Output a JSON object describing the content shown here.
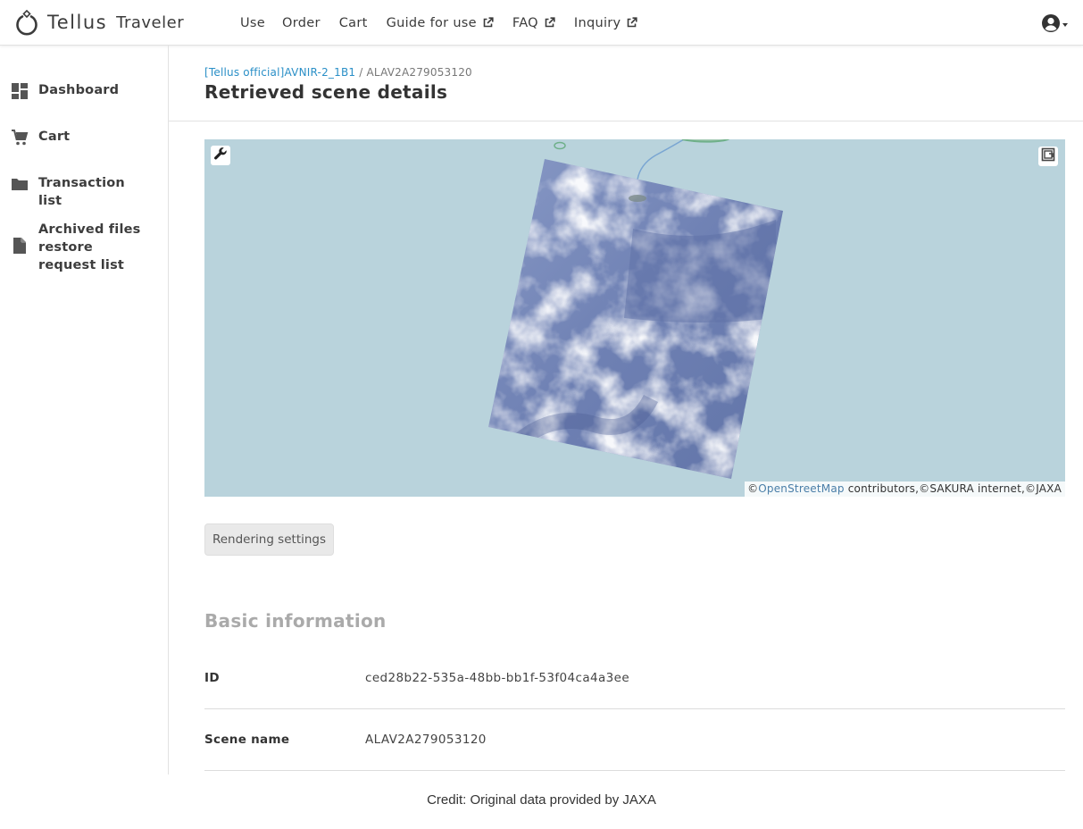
{
  "app": {
    "logo_text": "Tellus",
    "logo_sub": "Traveler"
  },
  "topnav": {
    "items": [
      {
        "label": "Use",
        "external": false
      },
      {
        "label": "Order",
        "external": false
      },
      {
        "label": "Cart",
        "external": false
      },
      {
        "label": "Guide for use",
        "external": true
      },
      {
        "label": "FAQ",
        "external": true
      },
      {
        "label": "Inquiry",
        "external": true
      }
    ],
    "user_icon": "user-circle-icon"
  },
  "sidebar": {
    "items": [
      {
        "label": "Dashboard",
        "icon": "dashboard-icon"
      },
      {
        "label": "Cart",
        "icon": "cart-icon"
      },
      {
        "label": "Transaction list",
        "icon": "folder-icon"
      },
      {
        "label": "Archived files restore request list",
        "icon": "file-icon"
      }
    ]
  },
  "breadcrumb": {
    "link": "[Tellus official]AVNIR-2_1B1",
    "separator": "/",
    "current": "ALAV2A279053120"
  },
  "page": {
    "title": "Retrieved scene details"
  },
  "map": {
    "attribution_prefix": "©",
    "attribution_link": "OpenStreetMap",
    "attribution_suffix": " contributors,©SAKURA internet,©JAXA",
    "tool_icon": "wrench-icon",
    "fullscreen_icon": "fullscreen-icon",
    "water_color": "#b9d3dc"
  },
  "buttons": {
    "rendering_settings": "Rendering settings"
  },
  "basic_info": {
    "section_title": "Basic information",
    "rows": [
      {
        "key": "ID",
        "value": "ced28b22-535a-48bb-bb1f-53f04ca4a3ee"
      },
      {
        "key": "Scene name",
        "value": "ALAV2A279053120"
      }
    ]
  },
  "footer": {
    "credit": "Credit: Original data provided by JAXA"
  }
}
